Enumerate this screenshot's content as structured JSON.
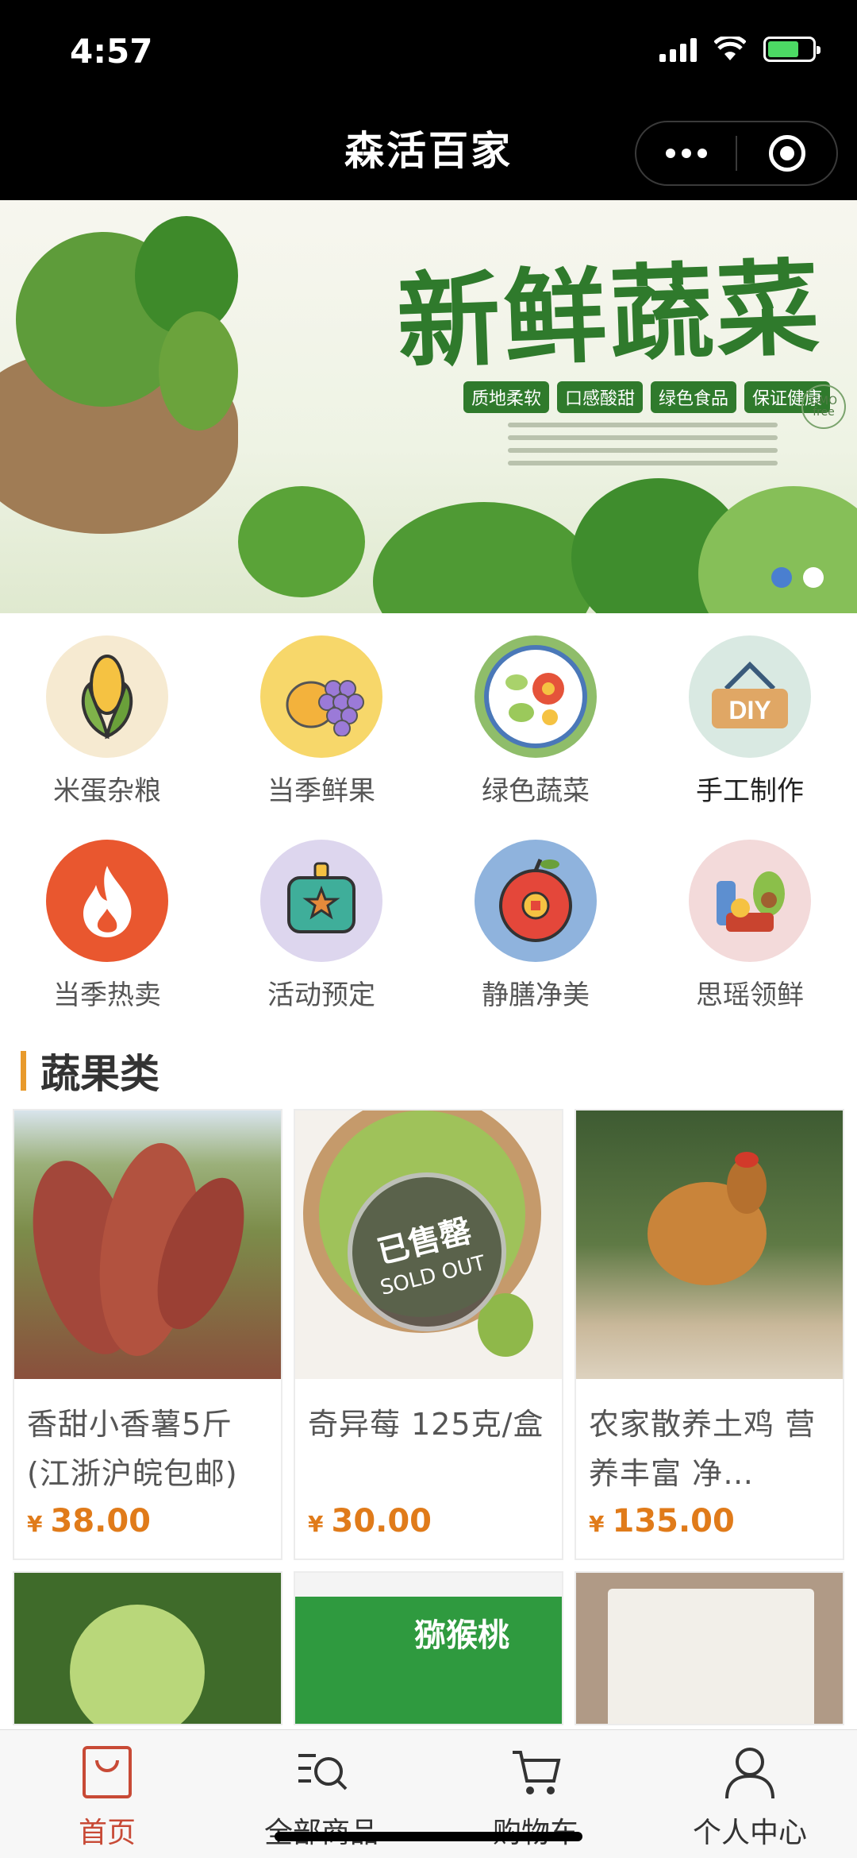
{
  "status_bar": {
    "time": "4:57"
  },
  "nav": {
    "title": "森活百家"
  },
  "banner": {
    "title": "新鲜蔬菜",
    "tags": [
      "质地柔软",
      "口感酸甜",
      "绿色食品",
      "保证健康"
    ],
    "badge": "GMO free",
    "colors": {
      "title": "#2f7a2c",
      "indicator_active": "#4a7fd0",
      "indicator_inactive": "#ffffff"
    }
  },
  "categories": [
    {
      "label": "米蛋杂粮",
      "icon": "corn-icon"
    },
    {
      "label": "当季鲜果",
      "icon": "fruit-icon"
    },
    {
      "label": "绿色蔬菜",
      "icon": "vegetable-plate-icon"
    },
    {
      "label": "手工制作",
      "icon": "diy-basket-icon"
    },
    {
      "label": "当季热卖",
      "icon": "flame-icon"
    },
    {
      "label": "活动预定",
      "icon": "gift-sign-icon"
    },
    {
      "label": "静膳净美",
      "icon": "apple-coin-icon"
    },
    {
      "label": "思瑶领鲜",
      "icon": "grocery-icon"
    }
  ],
  "section": {
    "title": "蔬果类"
  },
  "products": [
    {
      "name": "香甜小香薯5斤(江浙沪皖包邮)",
      "currency": "¥",
      "price": "38.00",
      "sold_out": false
    },
    {
      "name": "奇异莓 125克/盒",
      "currency": "¥",
      "price": "30.00",
      "sold_out": true,
      "sold_out_cn": "已售罄",
      "sold_out_en": "SOLD OUT"
    },
    {
      "name": "农家散养土鸡 营养丰富 净…",
      "currency": "¥",
      "price": "135.00",
      "sold_out": false
    },
    {
      "name": "",
      "image_text": ""
    },
    {
      "name": "",
      "image_text": "猕猴桃"
    },
    {
      "name": "",
      "image_text": ""
    }
  ],
  "tabbar": {
    "items": [
      {
        "label": "首页",
        "icon": "shopping-bag-icon",
        "active": true
      },
      {
        "label": "全部商品",
        "icon": "search-list-icon",
        "active": false
      },
      {
        "label": "购物车",
        "icon": "cart-icon",
        "active": false
      },
      {
        "label": "个人中心",
        "icon": "user-icon",
        "active": false
      }
    ],
    "active_color": "#c84a36"
  },
  "colors": {
    "price": "#e07b1a",
    "section_accent": "#e89a2c"
  }
}
